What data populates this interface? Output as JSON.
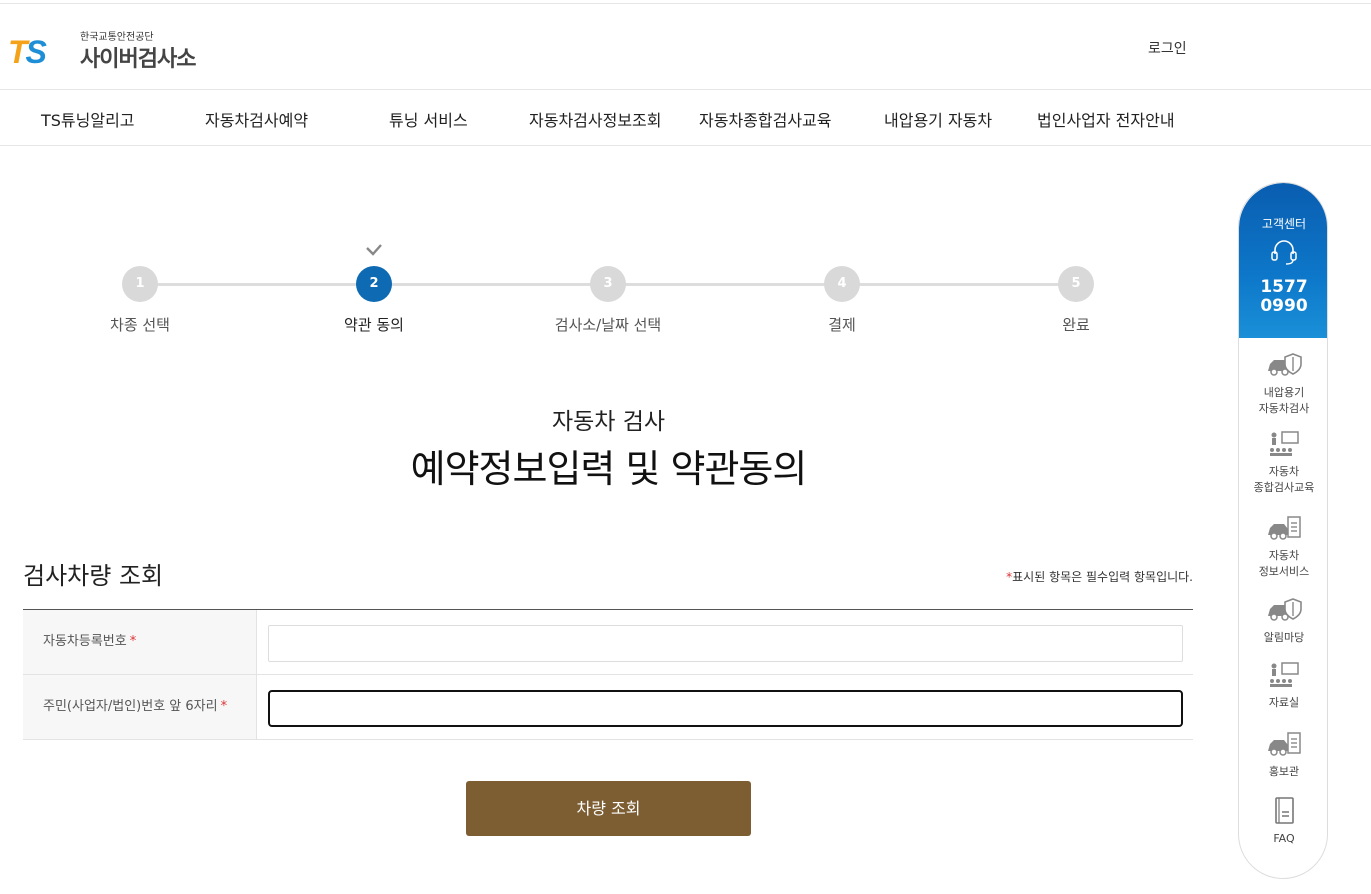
{
  "logo": {
    "mark_t": "T",
    "mark_s": "S",
    "sub": "한국교통안전공단",
    "main": "사이버검사소"
  },
  "header": {
    "login": "로그인"
  },
  "gnb": [
    "TS튜닝알리고",
    "자동차검사예약",
    "튜닝 서비스",
    "자동차검사정보조회",
    "자동차종합검사교육",
    "내압용기 자동차",
    "법인사업자 전자안내"
  ],
  "steps": [
    {
      "num": "1",
      "label": "차종 선택"
    },
    {
      "num": "2",
      "label": "약관 동의"
    },
    {
      "num": "3",
      "label": "검사소/날짜 선택"
    },
    {
      "num": "4",
      "label": "결제"
    },
    {
      "num": "5",
      "label": "완료"
    }
  ],
  "active_step": 2,
  "title": {
    "sub": "자동차 검사",
    "main": "예약정보입력 및 약관동의"
  },
  "section": {
    "title": "검사차량 조회",
    "req_star": "*",
    "req_note": "표시된 항목은 필수입력 항목입니다."
  },
  "form": {
    "rows": [
      {
        "label": "자동차등록번호",
        "star": "*",
        "value": "",
        "placeholder": ""
      },
      {
        "label": "주민(사업자/법인)번호 앞 6자리",
        "star": "*",
        "value": "",
        "placeholder": ""
      }
    ]
  },
  "button": {
    "search": "차량 조회"
  },
  "quick": {
    "top_label": "고객센터",
    "phone_1": "1577",
    "phone_2": "0990",
    "items": [
      {
        "line1": "내압용기",
        "line2": "자동차검사",
        "icon": "car-shield-icon"
      },
      {
        "line1": "자동차",
        "line2": "종합검사교육",
        "icon": "classroom-icon"
      },
      {
        "line1": "자동차",
        "line2": "정보서비스",
        "icon": "car-clipboard-icon"
      },
      {
        "line1": "알림마당",
        "line2": "",
        "icon": "car-shield-icon"
      },
      {
        "line1": "자료실",
        "line2": "",
        "icon": "classroom-icon"
      },
      {
        "line1": "홍보관",
        "line2": "",
        "icon": "car-clipboard-icon"
      },
      {
        "line1": "FAQ",
        "line2": "",
        "icon": "notebook-icon"
      }
    ]
  },
  "colors": {
    "primary_blue": "#0e6ab2",
    "button_brown": "#7d5e33",
    "required_red": "#d33333"
  }
}
